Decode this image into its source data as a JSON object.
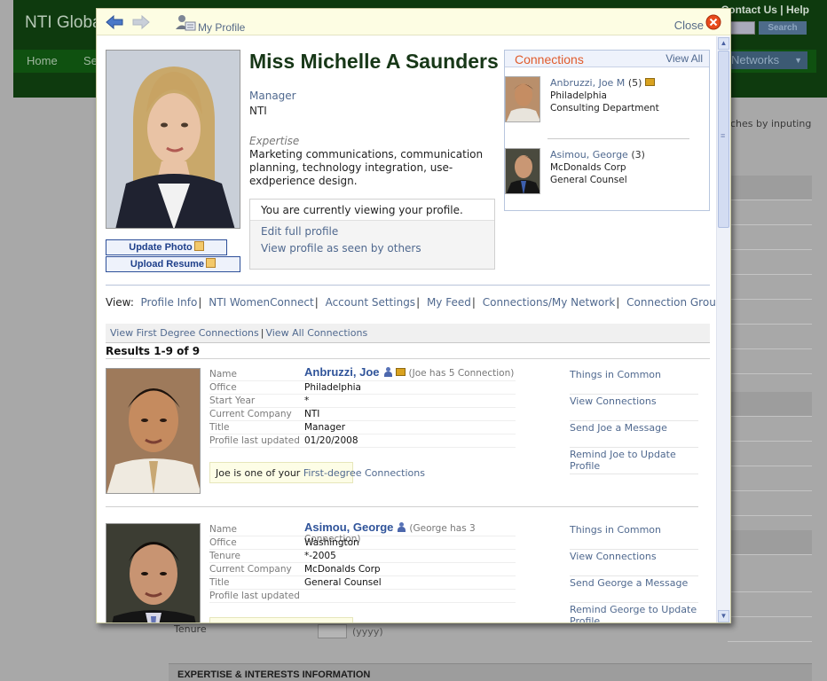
{
  "background": {
    "logo": "NTI Globa",
    "top_links": [
      "Contact Us",
      "Help"
    ],
    "search_button": "Search",
    "nav": [
      "Home",
      "Se"
    ],
    "networks": "Networks",
    "hint": "ches by inputing",
    "tenure_label": "Tenure",
    "tenure_hint": "(yyyy)",
    "expertise_header": "EXPERTISE & INTERESTS INFORMATION"
  },
  "modal": {
    "my_profile": "My Profile",
    "close": "Close"
  },
  "profile": {
    "name": "Miss Michelle A Saunders",
    "role": "Manager",
    "company": "NTI",
    "expertise_label": "Expertise",
    "expertise": "Marketing communications, communication planning, technology integration, use-exdperience design.",
    "update_photo": "Update Photo",
    "upload_resume": "Upload Resume",
    "viewing_message": "You are currently viewing your profile.",
    "edit_full_profile": "Edit full profile",
    "view_as_others": "View profile as seen by others"
  },
  "connections": {
    "title": "Connections",
    "view_all": "View All",
    "items": [
      {
        "name": "Anbruzzi, Joe M",
        "count": "(5)",
        "city": "Philadelphia",
        "dept": "Consulting Department"
      },
      {
        "name": "Asimou, George",
        "count": "(3)",
        "city": "McDonalds Corp",
        "dept": "General Counsel"
      }
    ]
  },
  "view_menu": {
    "label": "View:",
    "items": [
      "Profile Info",
      "NTI WomenConnect",
      "Account Settings",
      "My Feed",
      "Connections/My Network",
      "Connection Groups"
    ]
  },
  "subnav": {
    "first_degree": "View First Degree Connections",
    "all": "View All Connections"
  },
  "results_count": "Results 1-9 of 9",
  "results": [
    {
      "name": "Anbruzzi, Joe",
      "note": "(Joe has 5 Connection)",
      "fields": [
        {
          "label": "Name",
          "value": ""
        },
        {
          "label": "Office",
          "value": "Philadelphia"
        },
        {
          "label": "Start Year",
          "value": "*"
        },
        {
          "label": "Current Company",
          "value": "NTI"
        },
        {
          "label": "Title",
          "value": "Manager"
        },
        {
          "label": "Profile last updated",
          "value": "01/20/2008"
        }
      ],
      "degree_prefix": "Joe is one of your ",
      "degree_link": "First-degree Connections",
      "actions": [
        "Things in Common",
        "View Connections",
        "Send Joe a Message",
        "Remind Joe to Update Profile"
      ]
    },
    {
      "name": "Asimou, George",
      "note": "(George has 3 Connection)",
      "fields": [
        {
          "label": "Name",
          "value": ""
        },
        {
          "label": "Office",
          "value": "Washington"
        },
        {
          "label": "Tenure",
          "value": "*-2005"
        },
        {
          "label": "Current Company",
          "value": "McDonalds Corp"
        },
        {
          "label": "Title",
          "value": "General Counsel"
        },
        {
          "label": "Profile last updated",
          "value": ""
        }
      ],
      "actions": [
        "Things in Common",
        "View Connections",
        "Send George a Message",
        "Remind George to Update Profile"
      ]
    }
  ],
  "colors": {
    "accent_green": "#173717",
    "link_blue": "#50698f",
    "connections_orange": "#e05b2c",
    "modal_header": "#fdfde3"
  }
}
